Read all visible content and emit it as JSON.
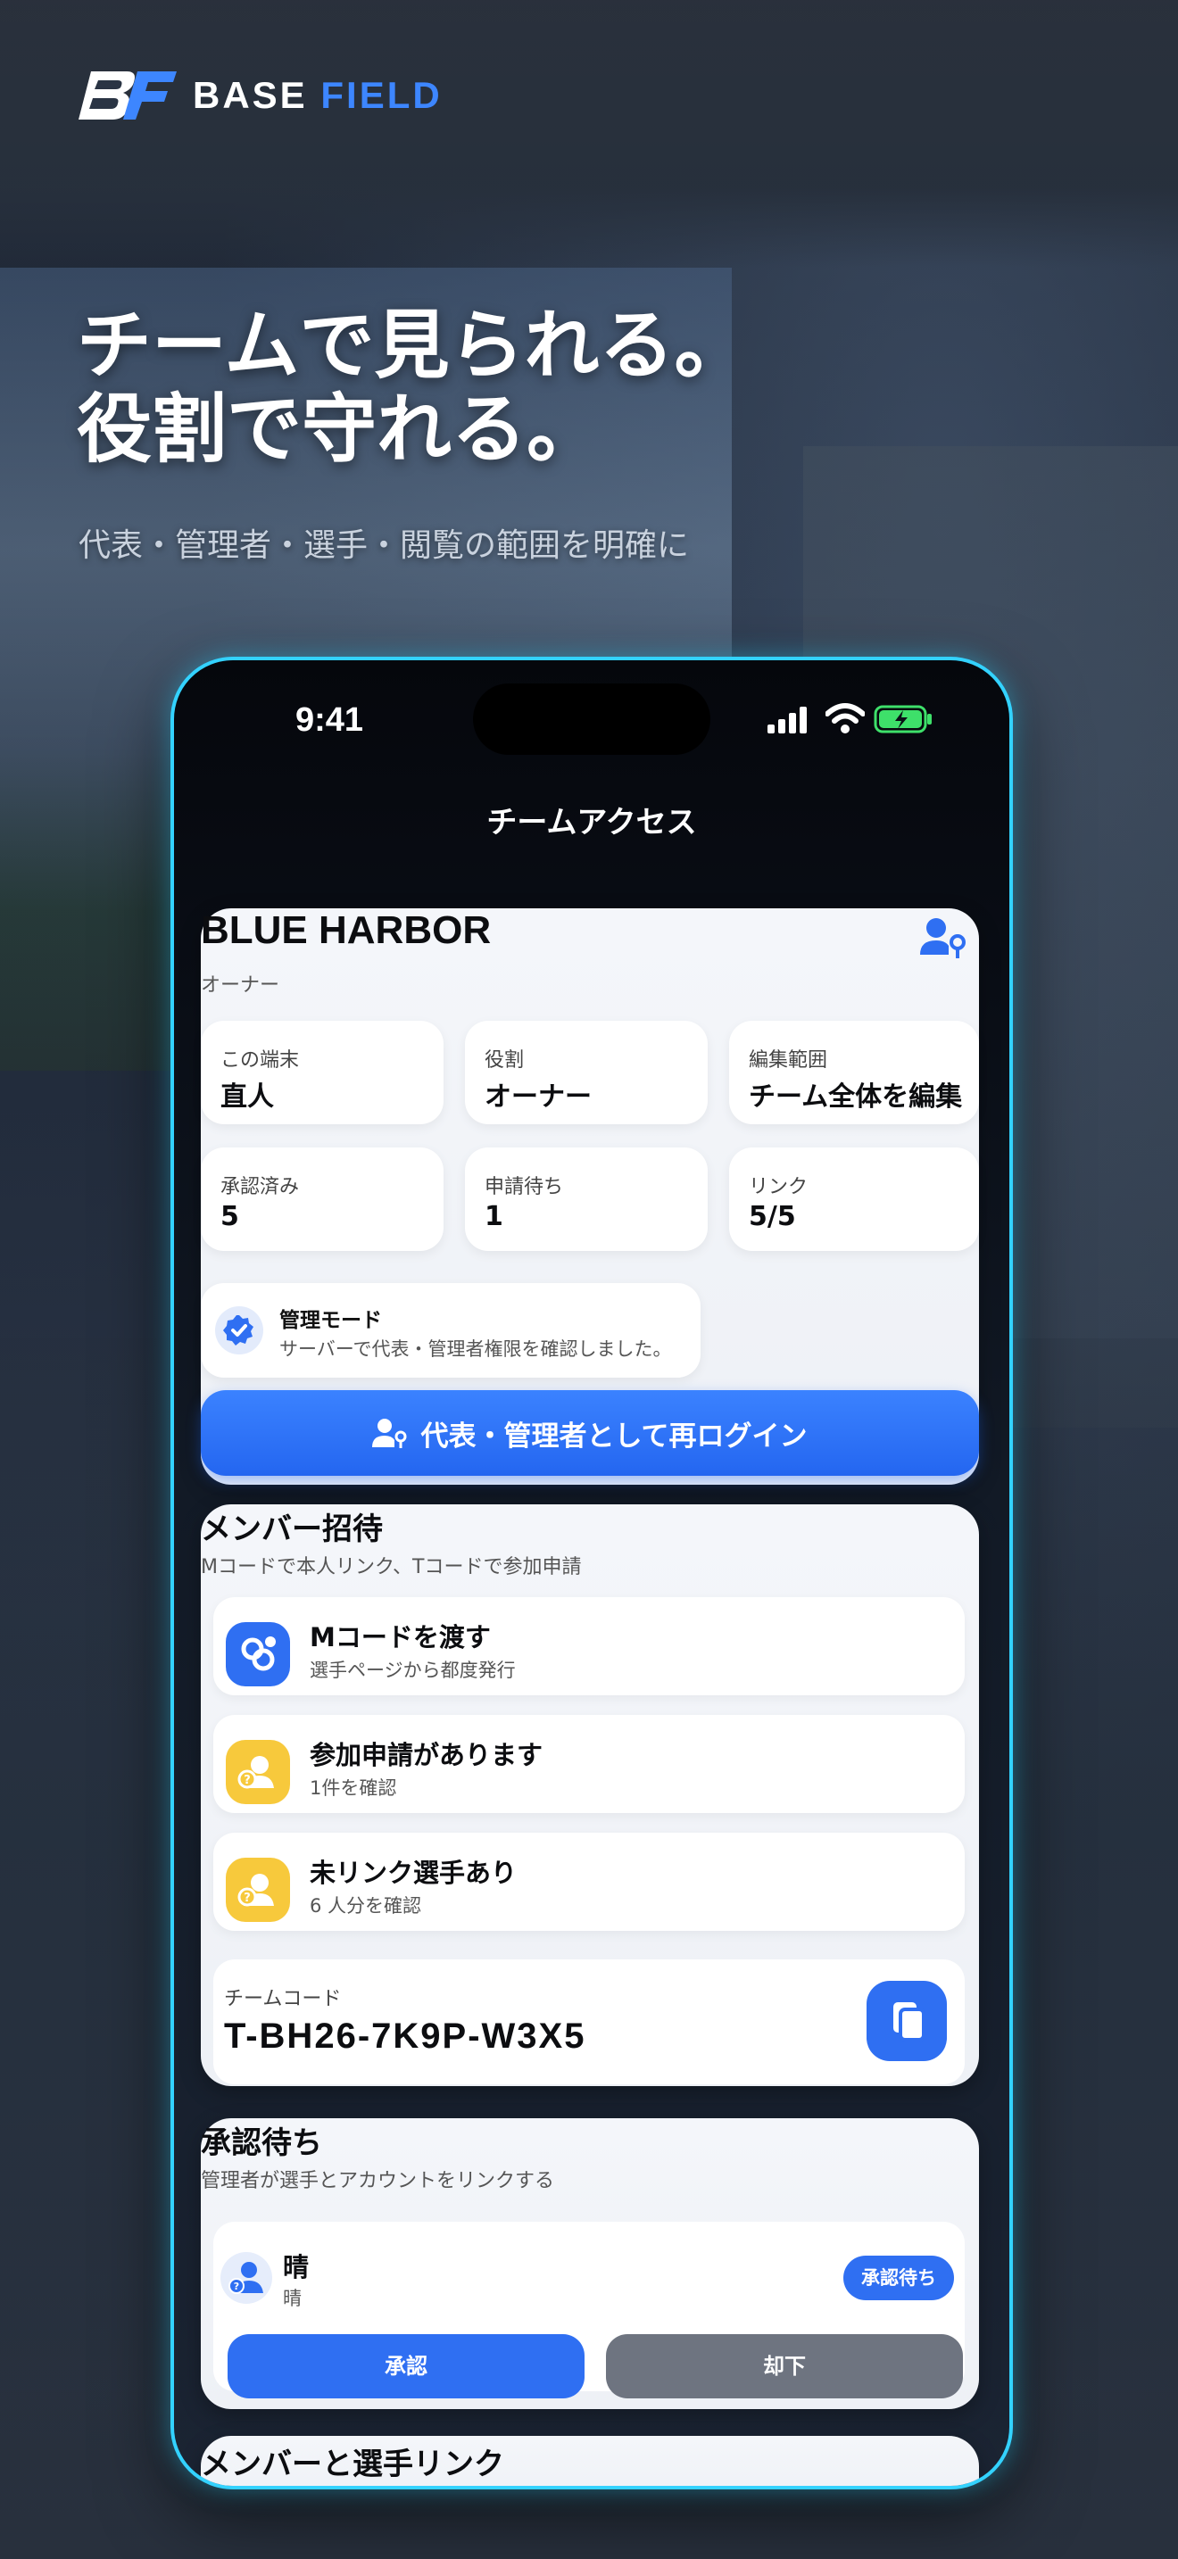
{
  "brand": {
    "word1": "BASE",
    "word2": "FIELD",
    "mark": "BF"
  },
  "headline": {
    "line1": "チームで見られる。",
    "line2": "役割で守れる。"
  },
  "subline": "代表・管理者・選手・閲覧の範囲を明確に",
  "status_bar": {
    "time": "9:41"
  },
  "nav": {
    "title": "チームアクセス"
  },
  "team": {
    "name": "BLUE HARBOR",
    "role": "オーナー",
    "tiles": [
      {
        "label": "この端末",
        "value": "直人"
      },
      {
        "label": "役割",
        "value": "オーナー"
      },
      {
        "label": "編集範囲",
        "value": "チーム全体を編集"
      },
      {
        "label": "承認済み",
        "value": "5"
      },
      {
        "label": "申請待ち",
        "value": "1"
      },
      {
        "label": "リンク",
        "value": "5/5"
      }
    ],
    "mode": {
      "title": "管理モード",
      "subtitle": "サーバーで代表・管理者権限を確認しました。"
    },
    "relogin_label": "代表・管理者として再ログイン"
  },
  "invite": {
    "title": "メンバー招待",
    "subtitle": "Mコードで本人リンク、Tコードで参加申請",
    "rows": [
      {
        "title": "Mコードを渡す",
        "subtitle": "選手ページから都度発行",
        "icon": "link-icon"
      },
      {
        "title": "参加申請があります",
        "subtitle": "1件を確認",
        "icon": "person-question-icon"
      },
      {
        "title": "未リンク選手あり",
        "subtitle": "6 人分を確認",
        "icon": "person-question-icon"
      }
    ],
    "team_code_label": "チームコード",
    "team_code": "T-BH26-7K9P-W3X5"
  },
  "pending": {
    "title": "承認待ち",
    "subtitle": "管理者が選手とアカウントをリンクする",
    "name": "晴",
    "sub": "晴",
    "badge": "承認待ち",
    "approve": "承認",
    "reject": "却下"
  },
  "members": {
    "title": "メンバーと選手リンク"
  },
  "colors": {
    "accent": "#2f6ff2",
    "phone_border": "#33d2ff",
    "warning": "#f7c93c"
  }
}
